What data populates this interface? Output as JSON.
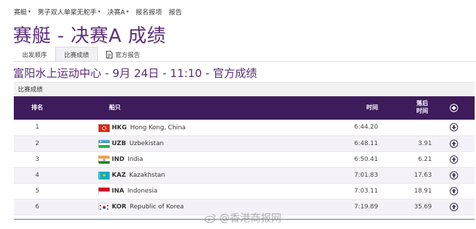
{
  "topnav": {
    "items": [
      {
        "label": "赛艇",
        "caret": true
      },
      {
        "label": "男子双人单桨无舵手",
        "caret": true
      },
      {
        "label": "决赛A",
        "caret": true
      },
      {
        "label": "报名报项",
        "caret": false
      },
      {
        "label": "报告",
        "caret": false
      }
    ]
  },
  "page": {
    "title": "赛艇 - 决赛A 成绩"
  },
  "tabs": [
    {
      "label": "出发顺序",
      "active": false
    },
    {
      "label": "比赛成绩",
      "active": true
    },
    {
      "label": "官方报告",
      "active": false,
      "icon": "document-icon"
    }
  ],
  "venue_line": "富阳水上运动中心 - 9月 24日 - 11:10 - 官方成绩",
  "section": {
    "title": "比赛成绩"
  },
  "table": {
    "headers": {
      "rank": "排名",
      "boat": "船只",
      "time": "时间",
      "gap": "落后 时间",
      "expand_icon": "plus-circle-icon"
    },
    "rows": [
      {
        "rank": "1",
        "code": "HKG",
        "country": "Hong Kong, China",
        "time": "6:44.20",
        "gap": "",
        "flag": "hkg"
      },
      {
        "rank": "2",
        "code": "UZB",
        "country": "Uzbekistan",
        "time": "6:48.11",
        "gap": "3.91",
        "flag": "uzb"
      },
      {
        "rank": "3",
        "code": "IND",
        "country": "India",
        "time": "6:50.41",
        "gap": "6.21",
        "flag": "ind"
      },
      {
        "rank": "4",
        "code": "KAZ",
        "country": "Kazakhstan",
        "time": "7:01.83",
        "gap": "17.63",
        "flag": "kaz"
      },
      {
        "rank": "5",
        "code": "INA",
        "country": "Indonesia",
        "time": "7:03.11",
        "gap": "18.91",
        "flag": "ina"
      },
      {
        "rank": "6",
        "code": "KOR",
        "country": "Republic of Korea",
        "time": "7:19.89",
        "gap": "35.69",
        "flag": "kor"
      }
    ]
  },
  "watermark": {
    "text": "@香港商报网",
    "icon": "weibo-icon"
  },
  "colors": {
    "title_purple": "#5b2d7a",
    "header_bg": "#3e1b5b",
    "row_alt": "#f4f2f8"
  }
}
